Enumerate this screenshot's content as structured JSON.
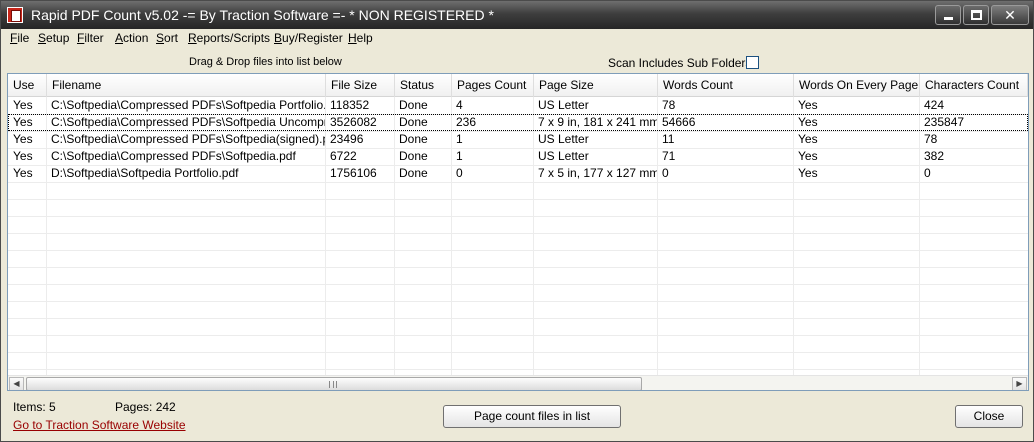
{
  "window": {
    "title": "Rapid PDF Count v5.02 -= By Traction Software =- * NON REGISTERED *",
    "minimize_glyph": "",
    "close_glyph": "✕"
  },
  "menu": [
    {
      "accel": "F",
      "rest": "ile"
    },
    {
      "accel": "S",
      "rest": "etup"
    },
    {
      "accel": "F",
      "rest": "ilter"
    },
    {
      "accel": "A",
      "rest": "ction"
    },
    {
      "accel": "S",
      "rest": "ort"
    },
    {
      "accel": "R",
      "rest": "eports/Scripts"
    },
    {
      "accel": "B",
      "rest": "uy/Register"
    },
    {
      "accel": "H",
      "rest": "elp"
    }
  ],
  "toolbar": {
    "drag_hint": "Drag & Drop files into list below",
    "scan_label": "Scan Includes Sub Folders",
    "scan_checked": false
  },
  "table": {
    "columns": [
      "Use",
      "Filename",
      "File Size",
      "Status",
      "Pages Count",
      "Page Size",
      "Words Count",
      "Words On Every Page",
      "Characters Count"
    ],
    "rows": [
      [
        "Yes",
        "C:\\Softpedia\\Compressed PDFs\\Softpedia Portfolio.pdf",
        "118352",
        "Done",
        "4",
        "US Letter",
        "78",
        "Yes",
        "424"
      ],
      [
        "Yes",
        "C:\\Softpedia\\Compressed PDFs\\Softpedia Uncompre...",
        "3526082",
        "Done",
        "236",
        "7 x 9 in, 181 x 241 mm",
        "54666",
        "Yes",
        "235847"
      ],
      [
        "Yes",
        "C:\\Softpedia\\Compressed PDFs\\Softpedia(signed).pdf",
        "23496",
        "Done",
        "1",
        "US Letter",
        "11",
        "Yes",
        "78"
      ],
      [
        "Yes",
        "C:\\Softpedia\\Compressed PDFs\\Softpedia.pdf",
        "6722",
        "Done",
        "1",
        "US Letter",
        "71",
        "Yes",
        "382"
      ],
      [
        "Yes",
        "D:\\Softpedia\\Softpedia Portfolio.pdf",
        "1756106",
        "Done",
        "0",
        "7 x 5 in, 177 x 127 mm",
        "0",
        "Yes",
        "0"
      ]
    ],
    "scroll_left_glyph": "◀",
    "scroll_right_glyph": "▶"
  },
  "status": {
    "items": "Items:  5",
    "pages": "Pages: 242",
    "link": "Go to Traction Software Website"
  },
  "buttons": {
    "count": "Page count files in list",
    "close": "Close"
  },
  "colors": {
    "titlebar": "#3e3e3e",
    "link": "#990000",
    "window_bg": "#ece9d8"
  }
}
